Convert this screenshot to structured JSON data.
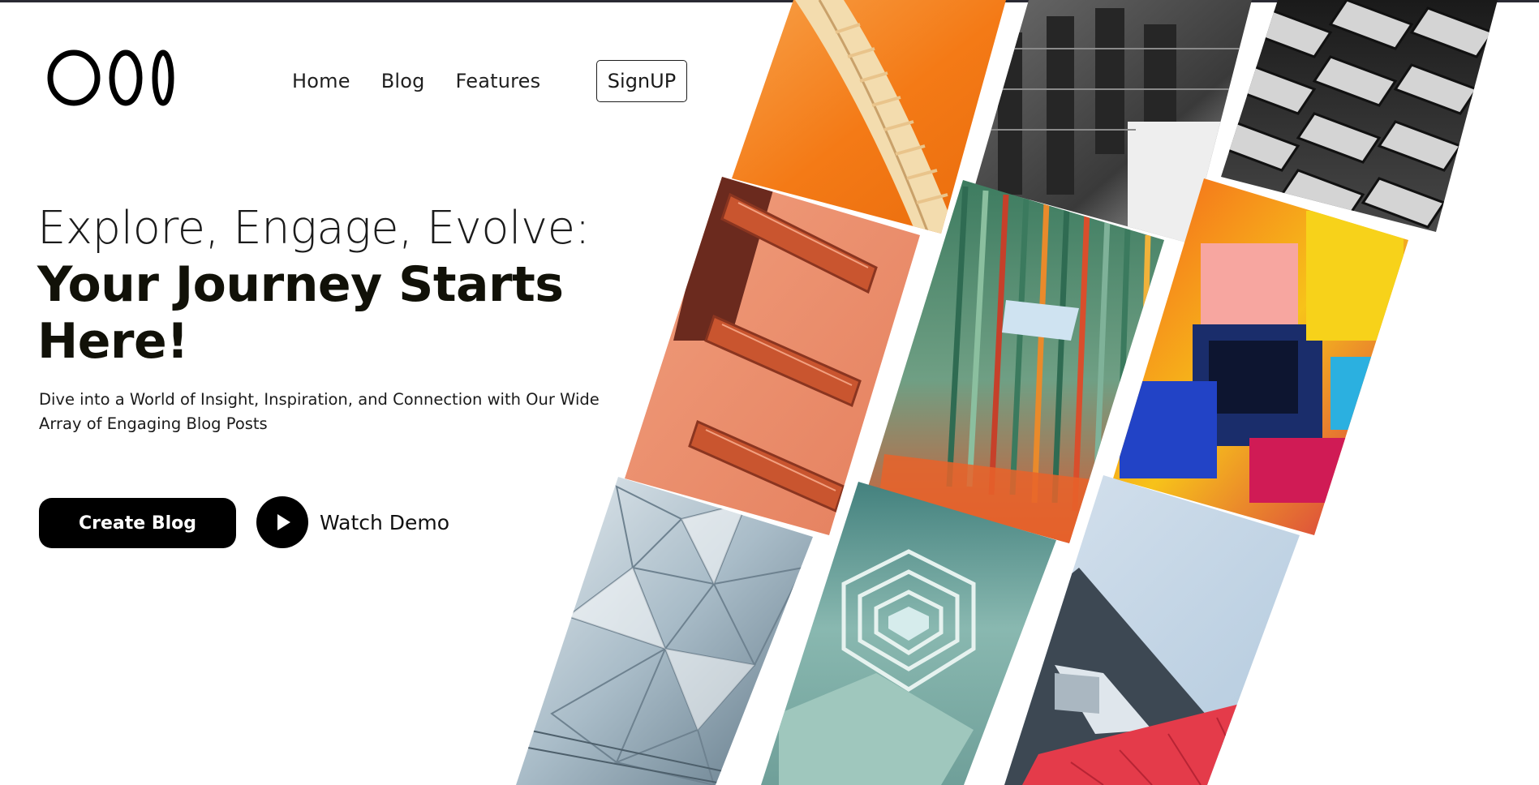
{
  "header": {
    "logo_text": "O0I",
    "nav": [
      {
        "label": "Home"
      },
      {
        "label": "Blog"
      },
      {
        "label": "Features"
      }
    ],
    "signup_label": "SignUP"
  },
  "hero": {
    "title_line1": "Explore, Engage, Evolve:",
    "title_line2": "Your Journey Starts Here!",
    "subtitle": "Dive into a World of Insight, Inspiration, and Connection with Our Wide Array of Engaging Blog Posts",
    "cta_primary": "Create Blog",
    "cta_secondary": "Watch Demo"
  },
  "gallery": {
    "tiles": [
      {
        "name": "orange-spiral-staircase-photo"
      },
      {
        "name": "gray-brutalist-building-photo"
      },
      {
        "name": "metal-facade-fins-photo"
      },
      {
        "name": "terracotta-fire-stairs-photo"
      },
      {
        "name": "striped-courtyard-facade-photo"
      },
      {
        "name": "colorful-abstract-painting-photo"
      },
      {
        "name": "triangular-glass-facade-photo"
      },
      {
        "name": "teal-hexagonal-stairwell-photo"
      },
      {
        "name": "gray-red-building-corner-photo"
      }
    ]
  },
  "colors": {
    "primary": "#000000",
    "text": "#141414",
    "background": "#ffffff"
  }
}
